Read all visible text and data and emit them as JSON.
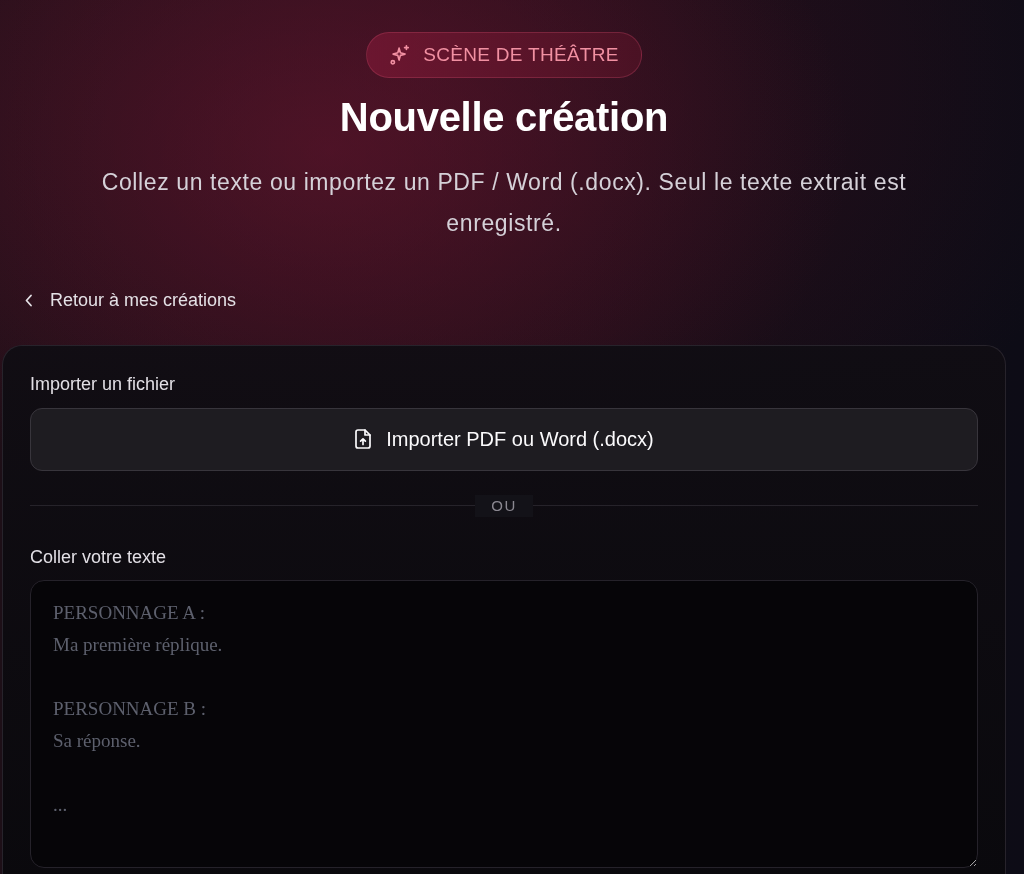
{
  "badge": {
    "text": "SCÈNE DE THÉÂTRE"
  },
  "title": "Nouvelle création",
  "subtitle": "Collez un texte ou importez un PDF / Word (.docx). Seul le texte extrait est enregistré.",
  "back_link": {
    "label": "Retour à mes créations"
  },
  "form": {
    "import_section": {
      "label": "Importer un fichier",
      "button": "Importer PDF ou Word (.docx)"
    },
    "separator": "OU",
    "paste_section": {
      "label": "Coller votre texte",
      "placeholder": "PERSONNAGE A :\nMa première réplique.\n\nPERSONNAGE B :\nSa réponse.\n\n..."
    }
  }
}
